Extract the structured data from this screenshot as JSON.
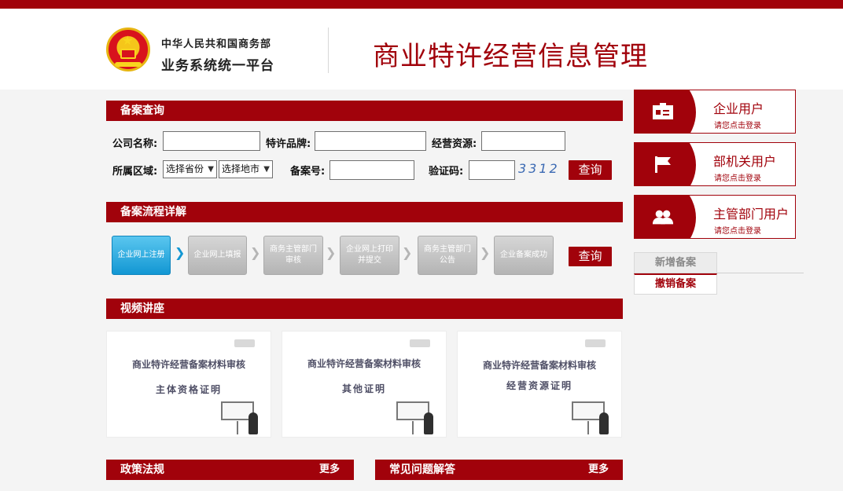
{
  "header": {
    "ministry_top": "中华人民共和国商务部",
    "ministry_bottom": "业务系统统一平台",
    "site_title": "商业特许经营信息管理"
  },
  "search": {
    "section_title": "备案查询",
    "company_label": "公司名称:",
    "brand_label": "特许品牌:",
    "resource_label": "经营资源:",
    "region_label": "所属区域:",
    "province_select": "选择省份",
    "city_select": "选择地市",
    "record_no_label": "备案号:",
    "captcha_label": "验证码:",
    "captcha_code": "3312",
    "query_button": "查询"
  },
  "process": {
    "section_title": "备案流程详解",
    "steps": [
      "企业网上注册",
      "企业网上填报",
      "商务主管部门审核",
      "企业网上打印并提交",
      "商务主管部门公告",
      "企业备案成功"
    ],
    "query_button": "查询"
  },
  "video": {
    "section_title": "视频讲座",
    "cards": [
      {
        "title": "商业特许经营备案材料审核",
        "subtitle": "主体资格证明"
      },
      {
        "title": "商业特许经营备案材料审核",
        "subtitle": "其他证明"
      },
      {
        "title": "商业特许经营备案材料审核",
        "subtitle": "经营资源证明"
      }
    ]
  },
  "footer_sections": {
    "policy": {
      "title": "政策法规",
      "more": "更多"
    },
    "faq": {
      "title": "常见问题解答",
      "more": "更多"
    }
  },
  "sidebar": {
    "enterprise_user": {
      "title": "企业用户",
      "sub": "请您点击登录"
    },
    "ministry_user": {
      "title": "部机关用户",
      "sub": "请您点击登录"
    },
    "competent_user": {
      "title": "主管部门用户",
      "sub": "请您点击登录"
    },
    "tabs": {
      "new_record": "新增备案",
      "cancel_record": "撤销备案"
    }
  },
  "colors": {
    "brand_red": "#a1020b",
    "active_step_blue": "#1297d3"
  }
}
